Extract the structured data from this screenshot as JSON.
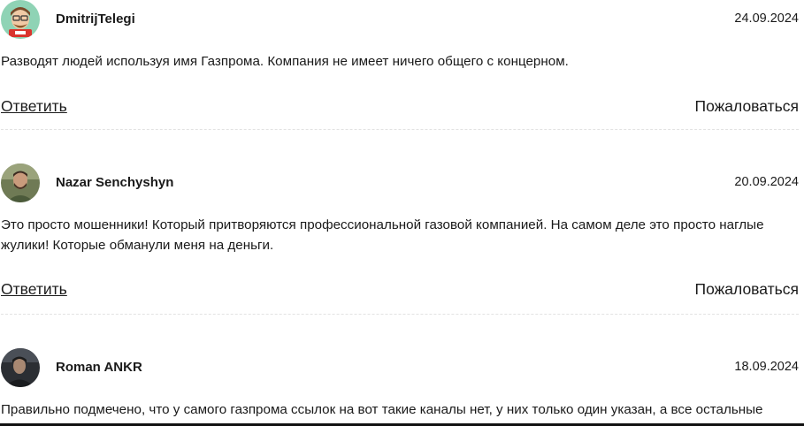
{
  "comments": [
    {
      "author": "DmitrijTelegi",
      "date": "24.09.2024",
      "text": "Разводят людей используя имя Газпрома. Компания не имеет ничего общего с концерном.",
      "reply_label": "Ответить",
      "report_label": "Пожаловаться"
    },
    {
      "author": "Nazar Senchyshyn",
      "date": "20.09.2024",
      "text": "Это просто мошенники! Который притворяются профессиональной газовой компанией. На самом деле это просто наглые жулики! Которые обманули меня на деньги.",
      "reply_label": "Ответить",
      "report_label": "Пожаловаться"
    },
    {
      "author": "Roman ANKR",
      "date": "18.09.2024",
      "text": "Правильно подмечено, что у самого газпрома ссылок на вот такие каналы нет, у них только один указан, а все остальные"
    }
  ]
}
